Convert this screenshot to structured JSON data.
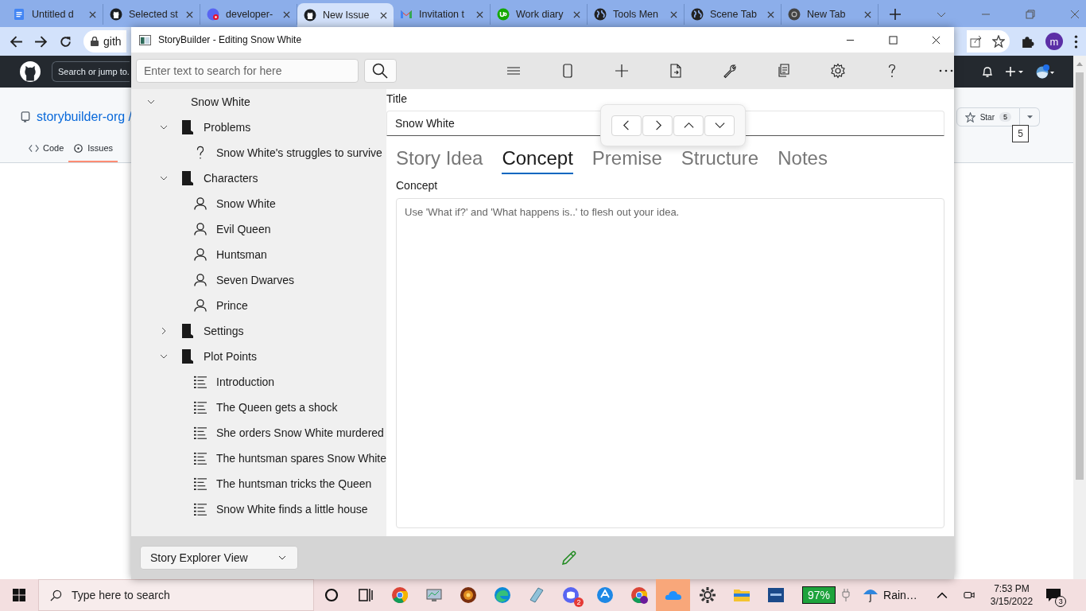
{
  "browser": {
    "tabs": [
      {
        "title": "Untitled d",
        "kind": "docs",
        "selected": false
      },
      {
        "title": "Selected st",
        "kind": "github",
        "selected": false
      },
      {
        "title": "developer-",
        "kind": "chat",
        "selected": false
      },
      {
        "title": "New Issue",
        "kind": "github",
        "selected": true
      },
      {
        "title": "Invitation t",
        "kind": "mail",
        "selected": false
      },
      {
        "title": "Work diary",
        "kind": "upwork",
        "selected": false
      },
      {
        "title": "Tools Men",
        "kind": "globe",
        "selected": false
      },
      {
        "title": "Scene Tab",
        "kind": "globe",
        "selected": false
      },
      {
        "title": "New Tab",
        "kind": "chrome",
        "selected": false
      }
    ],
    "address": "gith",
    "profile_initial": "m"
  },
  "github": {
    "search": "Search or jump to.",
    "repo": "storybuilder-org /",
    "nav": [
      {
        "label": "Code",
        "selected": false
      },
      {
        "label": "Issues",
        "selected": true
      }
    ],
    "star_label": "Star",
    "star_count": "5",
    "tooltip": "5"
  },
  "app": {
    "window_title": "StoryBuilder - Editing Snow White",
    "search": {
      "placeholder": "Enter text to search for here"
    },
    "tree": {
      "label": "Snow White",
      "kind": "root",
      "expanded": true,
      "children": [
        {
          "label": "Problems",
          "kind": "folder",
          "expanded": true,
          "children": [
            {
              "label": "Snow White's struggles to survive",
              "kind": "problem"
            }
          ]
        },
        {
          "label": "Characters",
          "kind": "folder",
          "expanded": true,
          "children": [
            {
              "label": "Snow White",
              "kind": "character"
            },
            {
              "label": "Evil Queen",
              "kind": "character"
            },
            {
              "label": "Huntsman",
              "kind": "character"
            },
            {
              "label": "Seven Dwarves",
              "kind": "character"
            },
            {
              "label": "Prince",
              "kind": "character"
            }
          ]
        },
        {
          "label": "Settings",
          "kind": "folder",
          "expanded": false
        },
        {
          "label": "Plot Points",
          "kind": "folder",
          "expanded": true,
          "children": [
            {
              "label": "Introduction",
              "kind": "plot"
            },
            {
              "label": "The Queen gets a shock",
              "kind": "plot"
            },
            {
              "label": "She orders Snow White murdered",
              "kind": "plot"
            },
            {
              "label": "The huntsman spares Snow White",
              "kind": "plot"
            },
            {
              "label": "The huntsman tricks the Queen",
              "kind": "plot"
            },
            {
              "label": "Snow White finds a little house",
              "kind": "plot"
            }
          ]
        }
      ]
    },
    "title_label": "Title",
    "title_value": "Snow White",
    "tabs": [
      {
        "label": "Story Idea",
        "selected": false
      },
      {
        "label": "Concept",
        "selected": true
      },
      {
        "label": "Premise",
        "selected": false
      },
      {
        "label": "Structure",
        "selected": false
      },
      {
        "label": "Notes",
        "selected": false
      }
    ],
    "section_label": "Concept",
    "concept": {
      "placeholder": "Use 'What if?' and 'What happens is..' to flesh out your idea."
    },
    "view": "Story Explorer View"
  },
  "taskbar": {
    "search": {
      "placeholder": "Type here to search"
    },
    "app_badge": "2",
    "battery": "97%",
    "weather": "Rain…",
    "time": "7:53 PM",
    "date": "3/15/2022",
    "notifications": "3"
  }
}
